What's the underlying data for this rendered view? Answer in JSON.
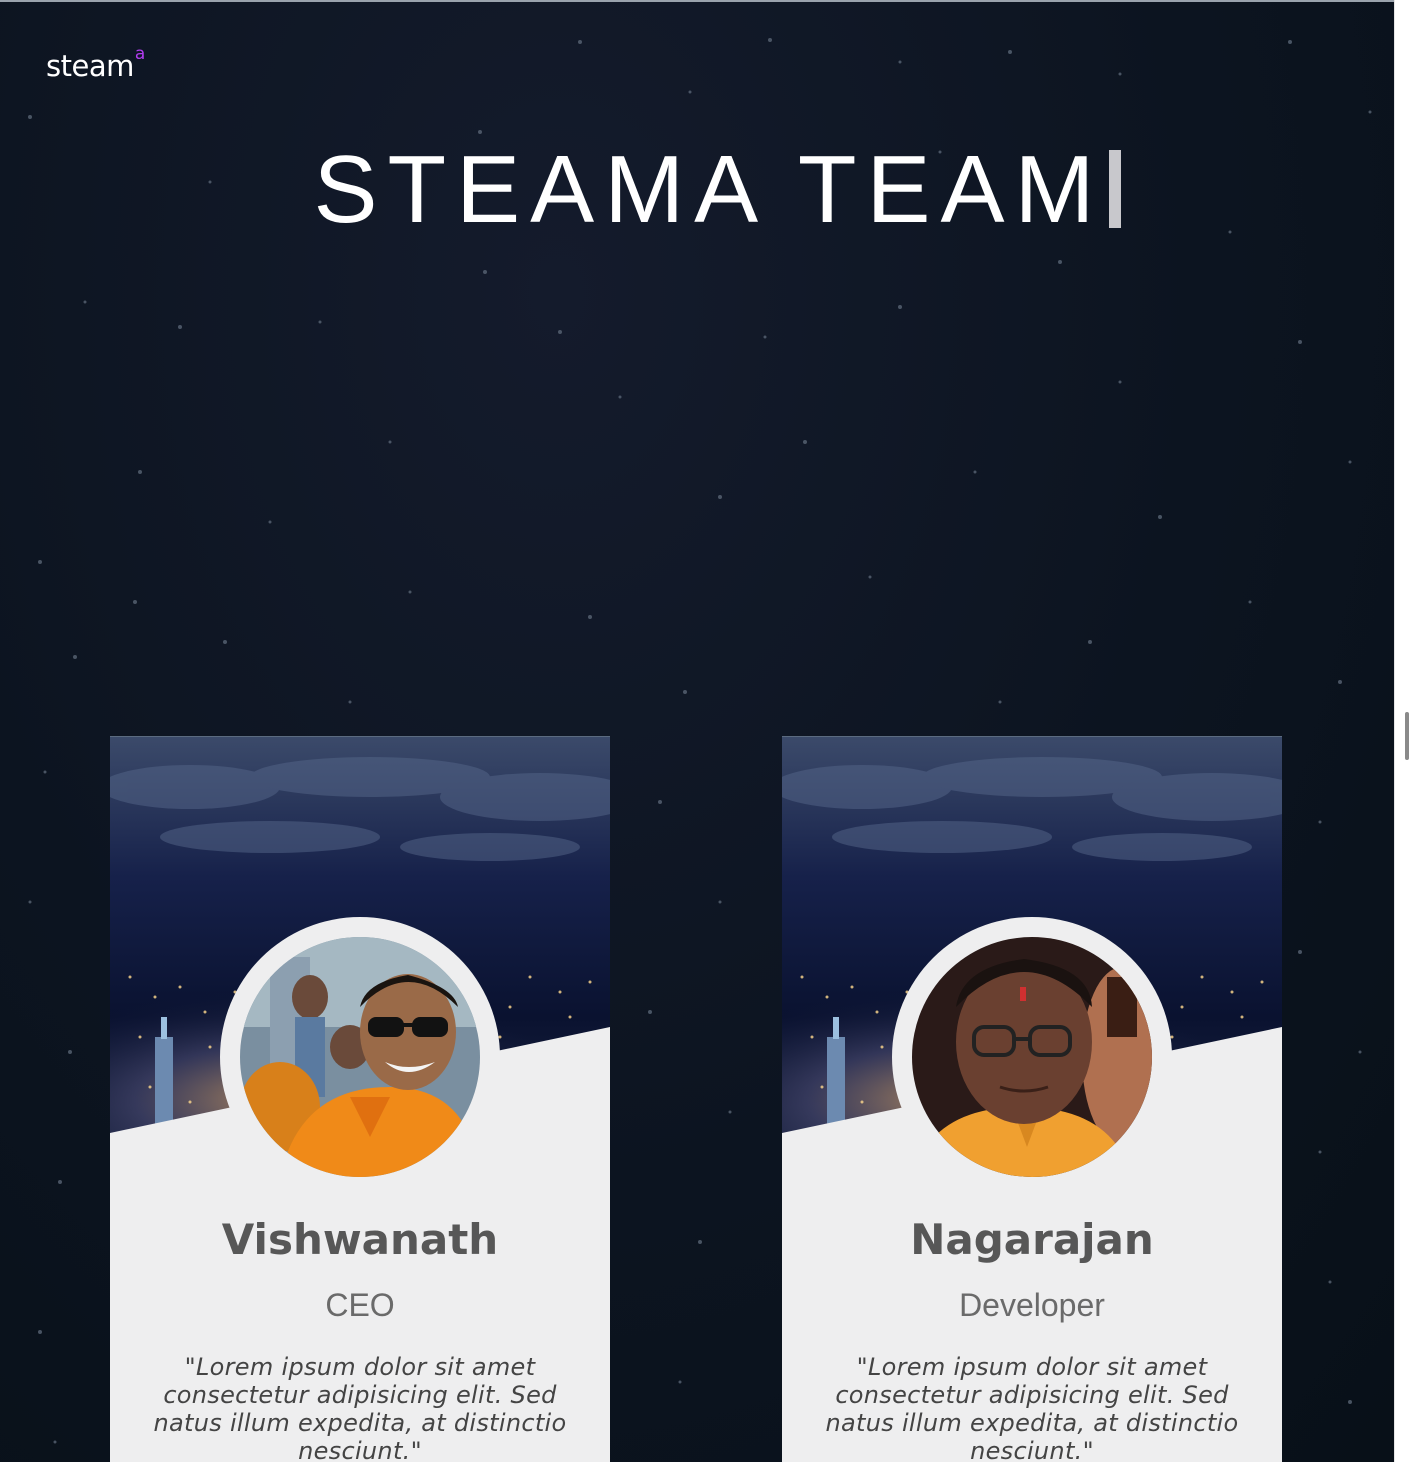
{
  "logo": {
    "text": "steam",
    "superscript": "a"
  },
  "title": "STEAMA TEAM",
  "colors": {
    "background": "#0c1420",
    "card": "#eeeeef",
    "logo_accent": "#b23cf0",
    "name": "#575757",
    "role": "#6a6a6a"
  },
  "team": [
    {
      "name": "Vishwanath",
      "role": "CEO",
      "quote": "\"Lorem ipsum dolor sit amet consectetur adipisicing elit. Sed natus illum expedita, at distinctio nesciunt.\""
    },
    {
      "name": "Nagarajan",
      "role": "Developer",
      "quote": "\"Lorem ipsum dolor sit amet consectetur adipisicing elit. Sed natus illum expedita, at distinctio nesciunt.\""
    }
  ]
}
